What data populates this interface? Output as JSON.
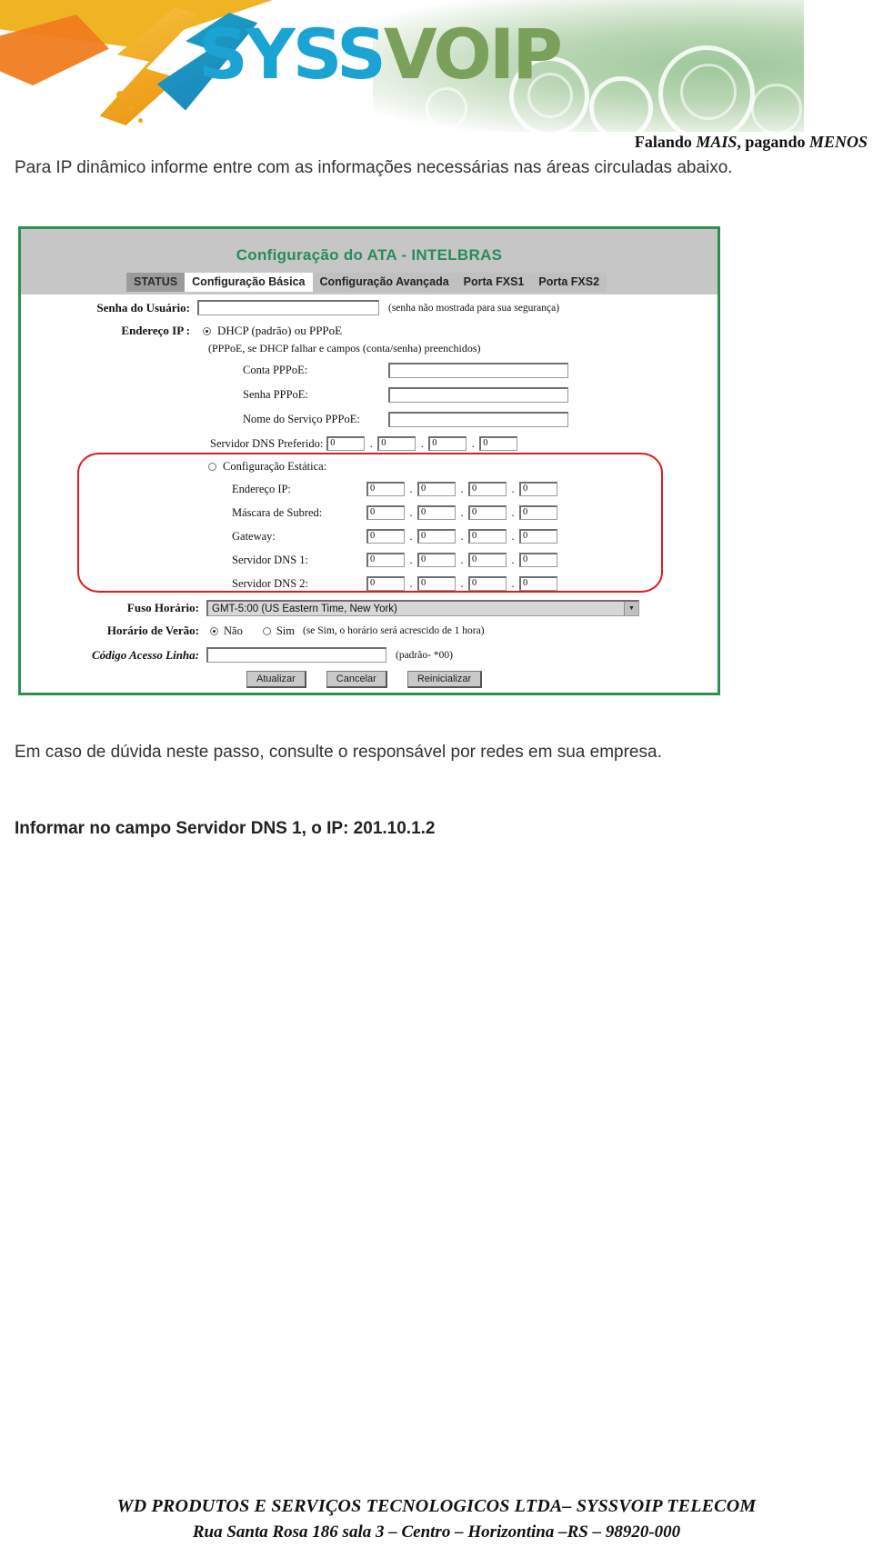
{
  "banner": {
    "logo_text_part1": "SYSS",
    "logo_text_part2": "VOIP",
    "tagline_prefix": "Falando ",
    "tagline_em1": "MAIS",
    "tagline_mid": ", pagando ",
    "tagline_em2": "MENOS"
  },
  "intro": {
    "paragraph": "Para IP dinâmico informe entre com as informações necessárias nas áreas circuladas abaixo."
  },
  "ata": {
    "title": "Configuração do ATA - INTELBRAS",
    "tabs": [
      {
        "label": "STATUS",
        "state": "status"
      },
      {
        "label": "Configuração Básica",
        "state": "active"
      },
      {
        "label": "Configuração Avançada",
        "state": "normal"
      },
      {
        "label": "Porta FXS1",
        "state": "normal"
      },
      {
        "label": "Porta FXS2",
        "state": "normal"
      }
    ],
    "user_password": {
      "label": "Senha do Usuário:",
      "value": "",
      "hint": "(senha não mostrada para sua segurança)"
    },
    "ip_address": {
      "label": "Endereço IP :",
      "dhcp_option": "DHCP (padrão) ou PPPoE",
      "dhcp_selected": true,
      "dhcp_note": "(PPPoE, se DHCP falhar e campos (conta/senha) preenchidos)",
      "pppoe_account": {
        "label": "Conta PPPoE:",
        "value": ""
      },
      "pppoe_password": {
        "label": "Senha PPPoE:",
        "value": ""
      },
      "pppoe_service": {
        "label": "Nome do Serviço PPPoE:",
        "value": ""
      },
      "dns_preferred": {
        "label": "Servidor DNS Preferido:",
        "octets": [
          "0",
          "0",
          "0",
          "0"
        ]
      },
      "static_option": "Configuração Estática:",
      "static_selected": false,
      "static_rows": [
        {
          "label": "Endereço IP:",
          "octets": [
            "0",
            "0",
            "0",
            "0"
          ]
        },
        {
          "label": "Máscara de Subred:",
          "octets": [
            "0",
            "0",
            "0",
            "0"
          ]
        },
        {
          "label": "Gateway:",
          "octets": [
            "0",
            "0",
            "0",
            "0"
          ]
        },
        {
          "label": "Servidor DNS 1:",
          "octets": [
            "0",
            "0",
            "0",
            "0"
          ]
        },
        {
          "label": "Servidor DNS 2:",
          "octets": [
            "0",
            "0",
            "0",
            "0"
          ]
        }
      ]
    },
    "timezone": {
      "label": "Fuso Horário:",
      "value": "GMT-5:00 (US Eastern Time, New York)"
    },
    "dst": {
      "label": "Horário de Verão:",
      "option_no": "Não",
      "option_yes": "Sim",
      "selected": "Não",
      "hint": "(se Sim, o horário será acrescido de 1 hora)"
    },
    "line_access_code": {
      "label": "Código Acesso Linha:",
      "value": "",
      "hint": "(padrão- *00)"
    },
    "buttons": {
      "update": "Atualizar",
      "cancel": "Cancelar",
      "reboot": "Reinicializar"
    },
    "colors": {
      "frame_green": "#2f8f4e",
      "title_green": "#2a8a5c",
      "highlight_red": "#e11b22",
      "header_grey": "#c6c6c6"
    }
  },
  "body": {
    "note": "Em caso de dúvida neste passo, consulte o responsável por redes em sua empresa.",
    "instruction": "Informar no campo Servidor DNS 1, o IP:  201.10.1.2"
  },
  "footer": {
    "line1": "WD PRODUTOS E SERVIÇOS TECNOLOGICOS LTDA– SYSSVOIP TELECOM",
    "line2": "Rua Santa Rosa 186 sala 3 – Centro – Horizontina –RS – 98920-000"
  }
}
